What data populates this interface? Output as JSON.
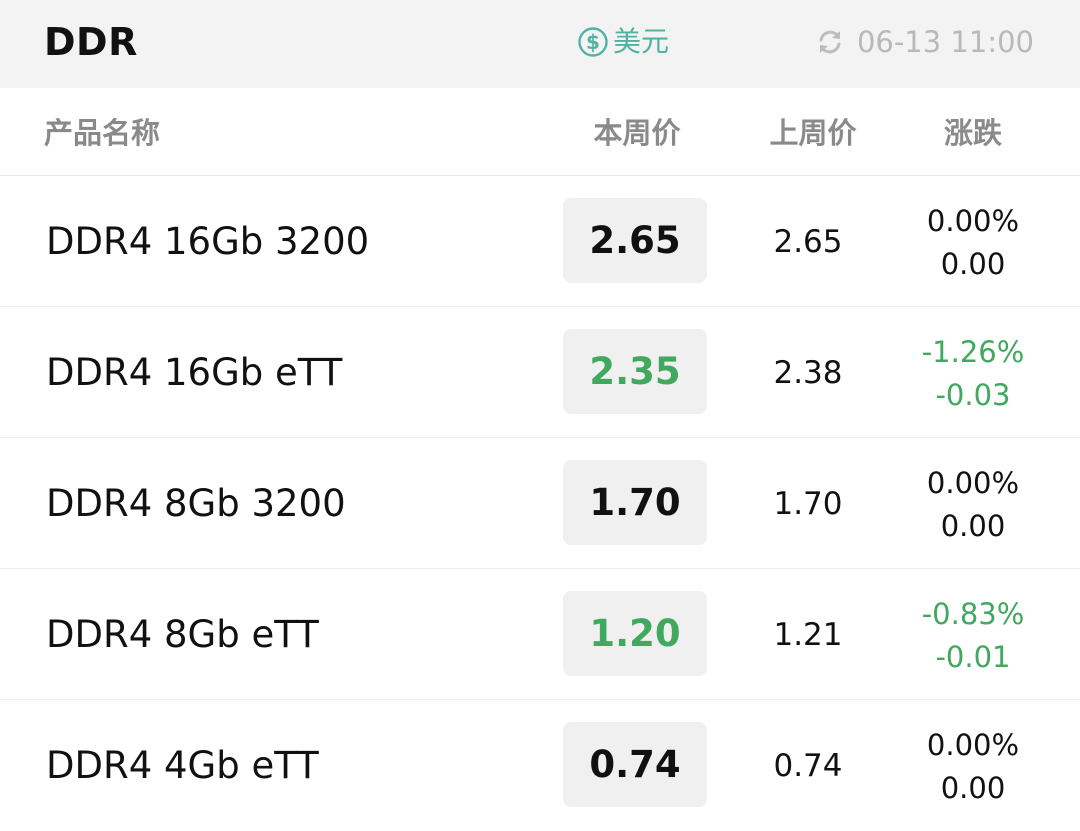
{
  "header": {
    "title": "DDR",
    "currency_label": "美元",
    "update_time": "06-13 11:00"
  },
  "columns": {
    "name": "产品名称",
    "this_week": "本周价",
    "last_week": "上周价",
    "change": "涨跌"
  },
  "rows": [
    {
      "name": "DDR4 16Gb 3200",
      "this_week": "2.65",
      "last_week": "2.65",
      "change_pct": "0.00%",
      "change_abs": "0.00",
      "trend": "flat"
    },
    {
      "name": "DDR4 16Gb eTT",
      "this_week": "2.35",
      "last_week": "2.38",
      "change_pct": "-1.26%",
      "change_abs": "-0.03",
      "trend": "down"
    },
    {
      "name": "DDR4 8Gb 3200",
      "this_week": "1.70",
      "last_week": "1.70",
      "change_pct": "0.00%",
      "change_abs": "0.00",
      "trend": "flat"
    },
    {
      "name": "DDR4 8Gb eTT",
      "this_week": "1.20",
      "last_week": "1.21",
      "change_pct": "-0.83%",
      "change_abs": "-0.01",
      "trend": "down"
    },
    {
      "name": "DDR4 4Gb eTT",
      "this_week": "0.74",
      "last_week": "0.74",
      "change_pct": "0.00%",
      "change_abs": "0.00",
      "trend": "flat"
    }
  ],
  "colors": {
    "accent_teal": "#4fb3a3",
    "down_green": "#41a85f",
    "muted_gray": "#b9b9b9",
    "topbar_bg": "#f3f3f3",
    "price_box_bg": "#f0f0f0"
  },
  "icons": {
    "currency": "dollar-circle-icon",
    "refresh": "refresh-icon"
  }
}
